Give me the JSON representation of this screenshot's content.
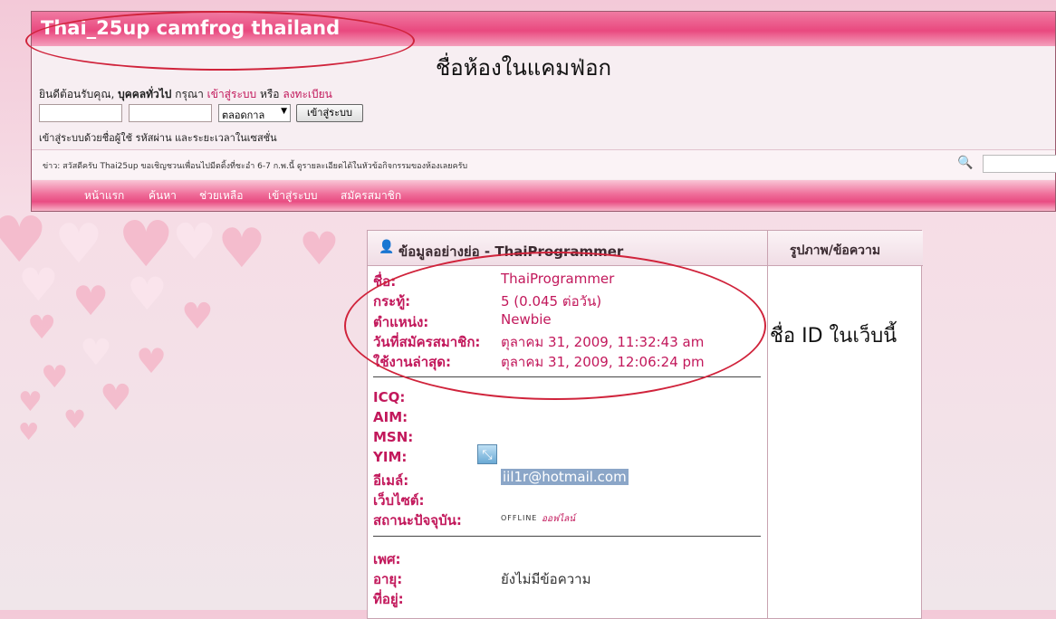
{
  "header": {
    "site_title": "Thai_25up camfrog thailand",
    "room_caption": "ชื่อห้องในแคมฟ่อก"
  },
  "login": {
    "welcome_prefix": "ยินดีต้อนรับคุณ, ",
    "guest": "บุคคลทั่วไป",
    "please": " กรุณา ",
    "login_link": "เข้าสู่ระบบ",
    "or": " หรือ ",
    "register_link": "ลงทะเบียน",
    "duration_selected": "ตลอดกาล",
    "login_button": "เข้าสู่ระบบ",
    "hint": "เข้าสู่ระบบด้วยชื่อผู้ใช้ รหัสผ่าน และระยะเวลาในเซสชั่น"
  },
  "news": "ข่าว: สวัสดีครับ Thai25up ขอเชิญชวนเพื่อนไปมีตติ้งที่ชะอำ 6-7 ก.พ.นี้ ดูรายละเอียดได้ในหัวข้อกิจกรรมของห้องเลยครับ",
  "nav": [
    "หน้าแรก",
    "ค้นหา",
    "ช่วยเหลือ",
    "เข้าสู่ระบบ",
    "สมัครสมาชิก"
  ],
  "profile": {
    "header_left": "ข้อมูลอย่างย่อ - ThaiProgrammer",
    "header_right": "รูปภาพ/ข้อความ",
    "id_caption": "ชื่อ ID ในเว็บนี้",
    "basic": [
      {
        "label": "ชื่อ:",
        "value": "ThaiProgrammer"
      },
      {
        "label": "กระทู้:",
        "value": "5 (0.045 ต่อวัน)"
      },
      {
        "label": "ตำแหน่ง:",
        "value": "Newbie"
      },
      {
        "label": "วันที่สมัครสมาชิก:",
        "value": "ตุลาคม 31, 2009, 11:32:43 am"
      },
      {
        "label": "ใช้งานล่าสุด:",
        "value": "ตุลาคม 31, 2009, 12:06:24 pm"
      }
    ],
    "contact": [
      {
        "label": "ICQ:",
        "value": ""
      },
      {
        "label": "AIM:",
        "value": ""
      },
      {
        "label": "MSN:",
        "value": ""
      },
      {
        "label": "YIM:",
        "value": ""
      },
      {
        "label": "อีเมล์:",
        "value": "iil1r@hotmail.com"
      },
      {
        "label": "เว็บไซต์:",
        "value": ""
      },
      {
        "label": "สถานะปัจจุบัน:",
        "value": ""
      }
    ],
    "status_offline": "OFFLINE",
    "status_offline_th": "ออฟไลน์",
    "extra": [
      {
        "label": "เพศ:",
        "value": ""
      },
      {
        "label": "อายุ:",
        "value": "ยังไม่มีข้อความ"
      },
      {
        "label": "ที่อยู่:",
        "value": ""
      }
    ]
  },
  "colors": {
    "accent": "#e94c82",
    "annotation": "#d0233b",
    "label": "#c2185b"
  }
}
